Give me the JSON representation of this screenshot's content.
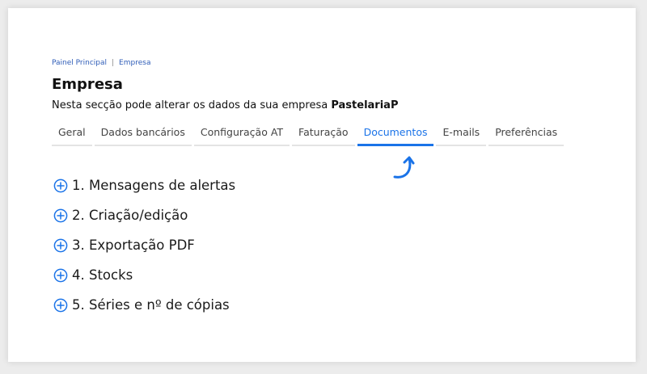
{
  "breadcrumb": {
    "home": "Painel Principal",
    "separator": "|",
    "current": "Empresa"
  },
  "page": {
    "title": "Empresa",
    "subtitle_prefix": "Nesta secção pode alterar os dados da sua empresa",
    "company_name": "PastelariaP"
  },
  "tabs": [
    {
      "label": "Geral"
    },
    {
      "label": "Dados bancários"
    },
    {
      "label": "Configuração AT"
    },
    {
      "label": "Faturação"
    },
    {
      "label": "Documentos",
      "active": true
    },
    {
      "label": "E-mails"
    },
    {
      "label": "Preferências"
    }
  ],
  "sections": [
    {
      "label": "1. Mensagens de alertas",
      "icon": "plus-circle-icon"
    },
    {
      "label": "2. Criação/edição",
      "icon": "plus-circle-icon"
    },
    {
      "label": "3. Exportação PDF",
      "icon": "plus-circle-icon"
    },
    {
      "label": "4. Stocks",
      "icon": "plus-circle-icon"
    },
    {
      "label": "5. Séries e nº de cópias",
      "icon": "plus-circle-icon"
    }
  ],
  "colors": {
    "accent": "#1a73e8",
    "link": "#2f5db8"
  }
}
